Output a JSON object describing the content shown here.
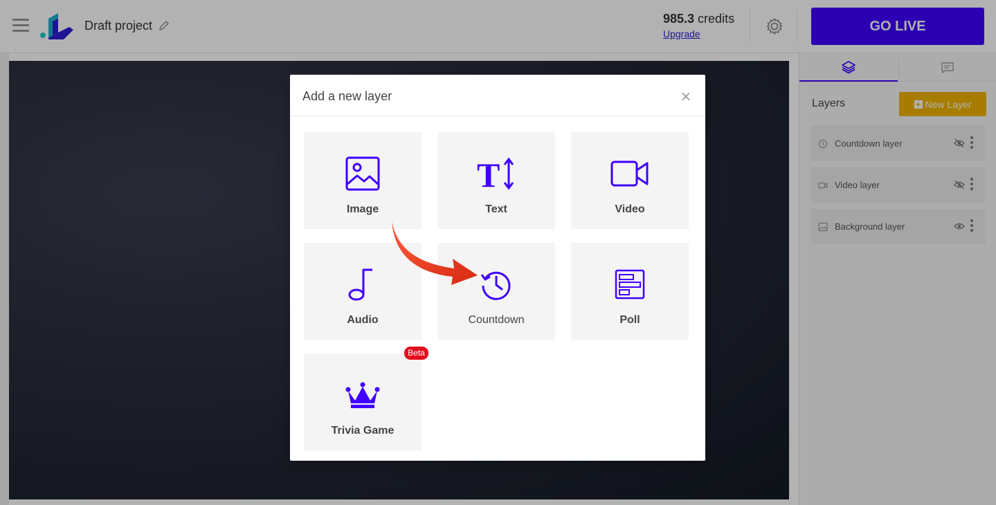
{
  "header": {
    "project_title": "Draft project",
    "credits_value": "985.3",
    "credits_unit": " credits",
    "upgrade_label": "Upgrade",
    "go_live_label": "GO LIVE"
  },
  "right_panel": {
    "layers_title": "Layers",
    "new_layer_label": "New Layer",
    "layers": [
      {
        "label": "Countdown layer",
        "icon": "clock-icon",
        "visible": false
      },
      {
        "label": "Video layer",
        "icon": "video-icon",
        "visible": false
      },
      {
        "label": "Background layer",
        "icon": "image-icon",
        "visible": true
      }
    ]
  },
  "modal": {
    "title": "Add a new layer",
    "close_label": "×",
    "tiles": [
      {
        "label": "Image",
        "icon": "image-icon"
      },
      {
        "label": "Text",
        "icon": "text-size-icon"
      },
      {
        "label": "Video",
        "icon": "video-camera-icon"
      },
      {
        "label": "Audio",
        "icon": "music-note-icon"
      },
      {
        "label": "Countdown",
        "icon": "countdown-clock-icon"
      },
      {
        "label": "Poll",
        "icon": "poll-icon"
      },
      {
        "label": "Trivia Game",
        "icon": "crown-icon"
      }
    ],
    "beta_label": "Beta"
  },
  "colors": {
    "accent": "#3f00ff",
    "new_layer": "#f0b400",
    "beta": "#e40e1f",
    "arrow": "#e8381c"
  }
}
